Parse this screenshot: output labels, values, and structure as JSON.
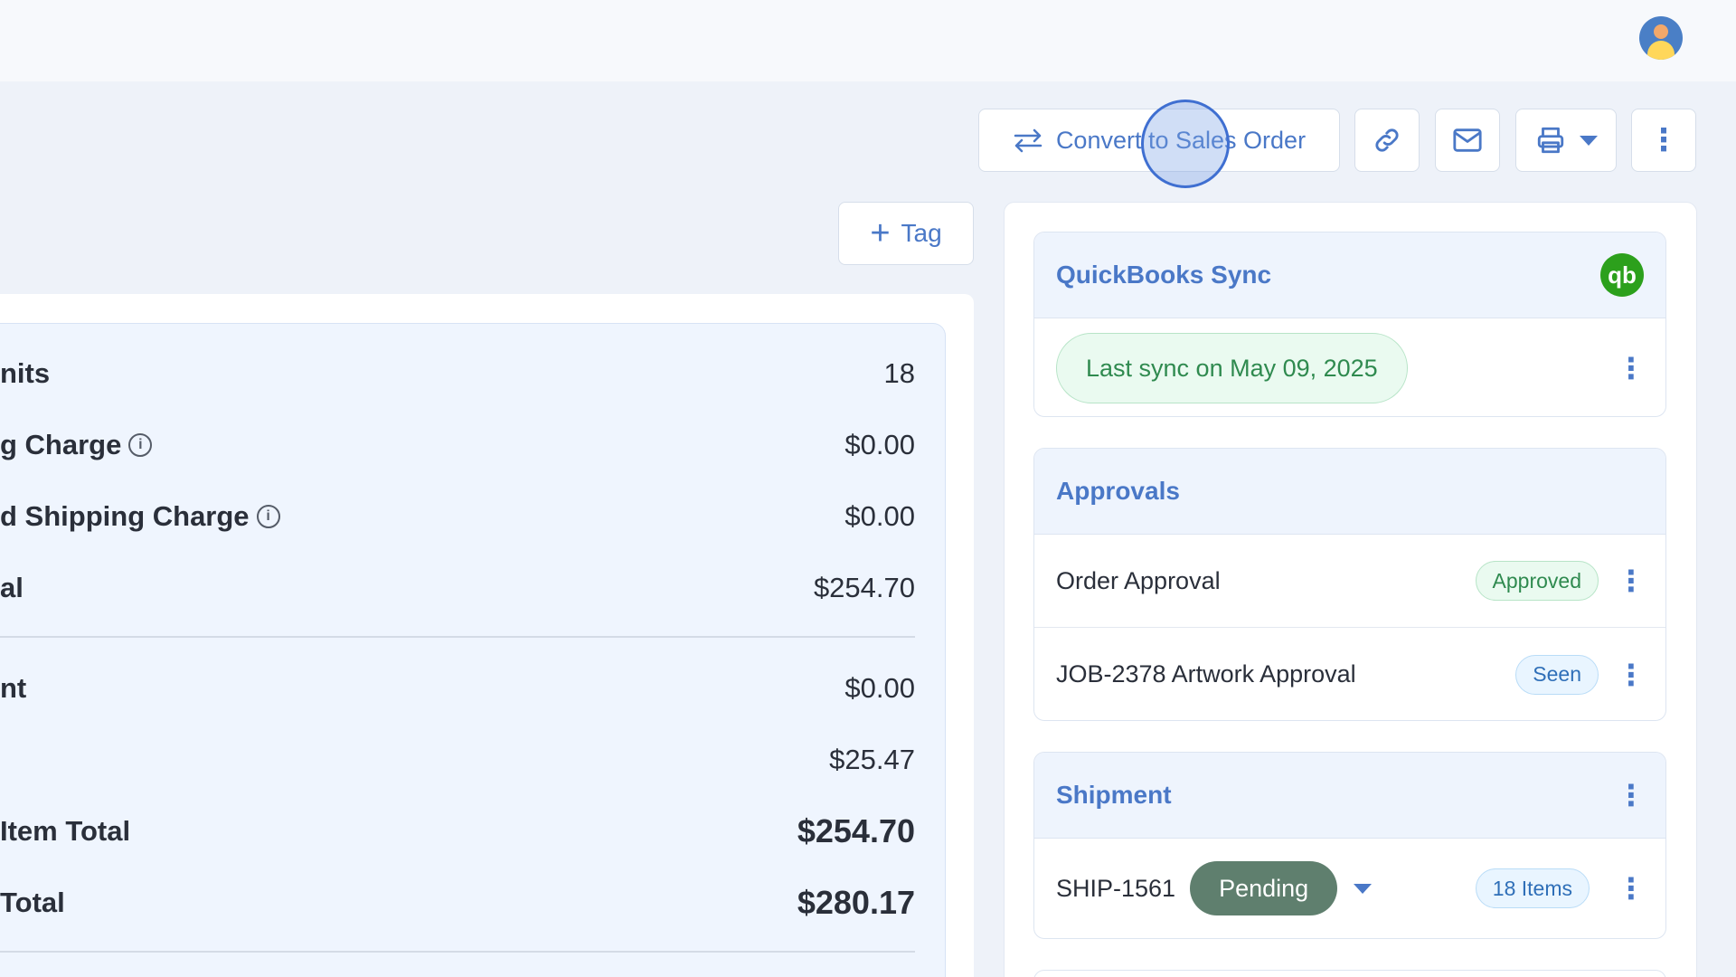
{
  "toolbar": {
    "convert_label": "Convert to Sales Order",
    "tag_label": "Tag"
  },
  "summary": {
    "rows": [
      {
        "label": "nits",
        "value": "18"
      },
      {
        "label": "g Charge",
        "value": "$0.00"
      },
      {
        "label": "d Shipping Charge",
        "value": "$0.00"
      },
      {
        "label": "al",
        "value": "$254.70"
      },
      {
        "label": "nt",
        "value": "$0.00"
      },
      {
        "label": "",
        "value": "$25.47"
      },
      {
        "label": "Item Total",
        "value": "$254.70"
      },
      {
        "label": "Total",
        "value": "$280.17"
      }
    ]
  },
  "quickbooks": {
    "title": "QuickBooks Sync",
    "logo_text": "qb",
    "last_sync": "Last sync on May 09, 2025"
  },
  "approvals": {
    "title": "Approvals",
    "items": [
      {
        "label": "Order Approval",
        "status": "Approved"
      },
      {
        "label": "JOB-2378 Artwork Approval",
        "status": "Seen"
      }
    ]
  },
  "shipment": {
    "title": "Shipment",
    "id": "SHIP-1561",
    "status": "Pending",
    "items_count": "18 Items"
  },
  "colors": {
    "accent": "#4a78c7",
    "success": "#2f8a4f",
    "pending": "#5f7f6e",
    "qb_green": "#2ca01c"
  }
}
